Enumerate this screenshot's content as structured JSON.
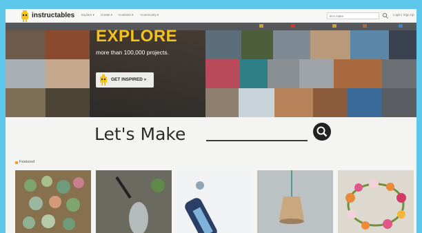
{
  "header": {
    "logo_text": "instructables",
    "nav": [
      {
        "label": "Explore ▾"
      },
      {
        "label": "Create ▾"
      },
      {
        "label": "Contests ▾"
      },
      {
        "label": "Community ▾"
      }
    ],
    "search_placeholder": "let's make",
    "login_label": "Login | Sign Up"
  },
  "channelbar": {
    "left_text": "",
    "channels": [
      {
        "label": ""
      },
      {
        "label": ""
      },
      {
        "label": ""
      },
      {
        "label": ""
      },
      {
        "label": ""
      }
    ]
  },
  "hero": {
    "title": "EXPLORE",
    "subtitle": "more than 100,000 projects.",
    "cta_label": "GET INSPIRED »"
  },
  "lets_make": {
    "heading": "Let's Make"
  },
  "featured": {
    "label": "Featured",
    "cards": [
      {
        "icon": "succulent-planter-photo"
      },
      {
        "icon": "garden-hose-sprinkler-photo"
      },
      {
        "icon": "fabric-bottle-holder-photo"
      },
      {
        "icon": "pendant-lamp-photo"
      },
      {
        "icon": "flower-crown-photo"
      }
    ]
  },
  "colors": {
    "frame_blue": "#5ec8ec",
    "channel_bar": "#55575a",
    "explore_yellow": "#f4c21a"
  }
}
